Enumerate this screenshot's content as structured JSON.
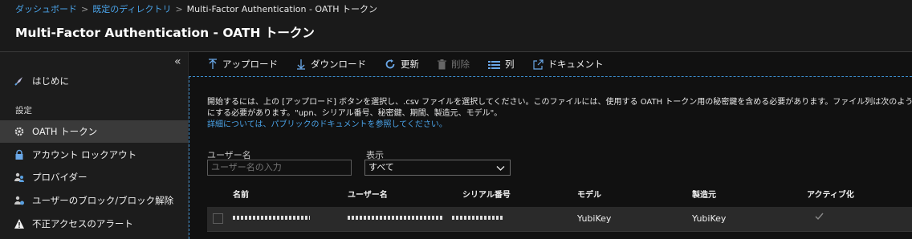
{
  "breadcrumb": {
    "items": [
      "ダッシュボード",
      "既定のディレクトリ",
      "Multi-Factor Authentication - OATH トークン"
    ],
    "separator": ">"
  },
  "header": {
    "title": "Multi-Factor Authentication - OATH トークン"
  },
  "sidebar": {
    "collapse_icon": "«",
    "getting_started": "はじめに",
    "section_label": "設定",
    "items": [
      {
        "label": "OATH トークン",
        "icon": "gear-icon",
        "active": true
      },
      {
        "label": "アカウント ロックアウト",
        "icon": "lock-icon"
      },
      {
        "label": "プロバイダー",
        "icon": "users-icon"
      },
      {
        "label": "ユーザーのブロック/ブロック解除",
        "icon": "user-block-icon"
      },
      {
        "label": "不正アクセスのアラート",
        "icon": "warning-icon"
      }
    ]
  },
  "toolbar": {
    "upload": "アップロード",
    "download": "ダウンロード",
    "refresh": "更新",
    "delete": "削除",
    "columns": "列",
    "docs": "ドキュメント"
  },
  "main": {
    "description": "開始するには、上の [アップロード] ボタンを選択し、.csv ファイルを選択してください。このファイルには、使用する OATH トークン用の秘密鍵を含める必要があります。ファイル列は次のようにする必要があります。\"upn、シリアル番号、秘密鍵、期間、製造元、モデル\"。",
    "more_link": "詳細については、パブリックのドキュメントを参照してください。",
    "username_label": "ユーザー名",
    "username_placeholder": "ユーザー名の入力",
    "display_label": "表示",
    "display_value": "すべて"
  },
  "table": {
    "columns": [
      "名前",
      "ユーザー名",
      "シリアル番号",
      "モデル",
      "製造元",
      "アクティブ化"
    ],
    "rows": [
      {
        "model": "YubiKey",
        "manufacturer": "YubiKey"
      }
    ]
  },
  "colors": {
    "accent": "#4aa3e8",
    "background": "#111111",
    "sidebar": "#1c1c1c"
  }
}
